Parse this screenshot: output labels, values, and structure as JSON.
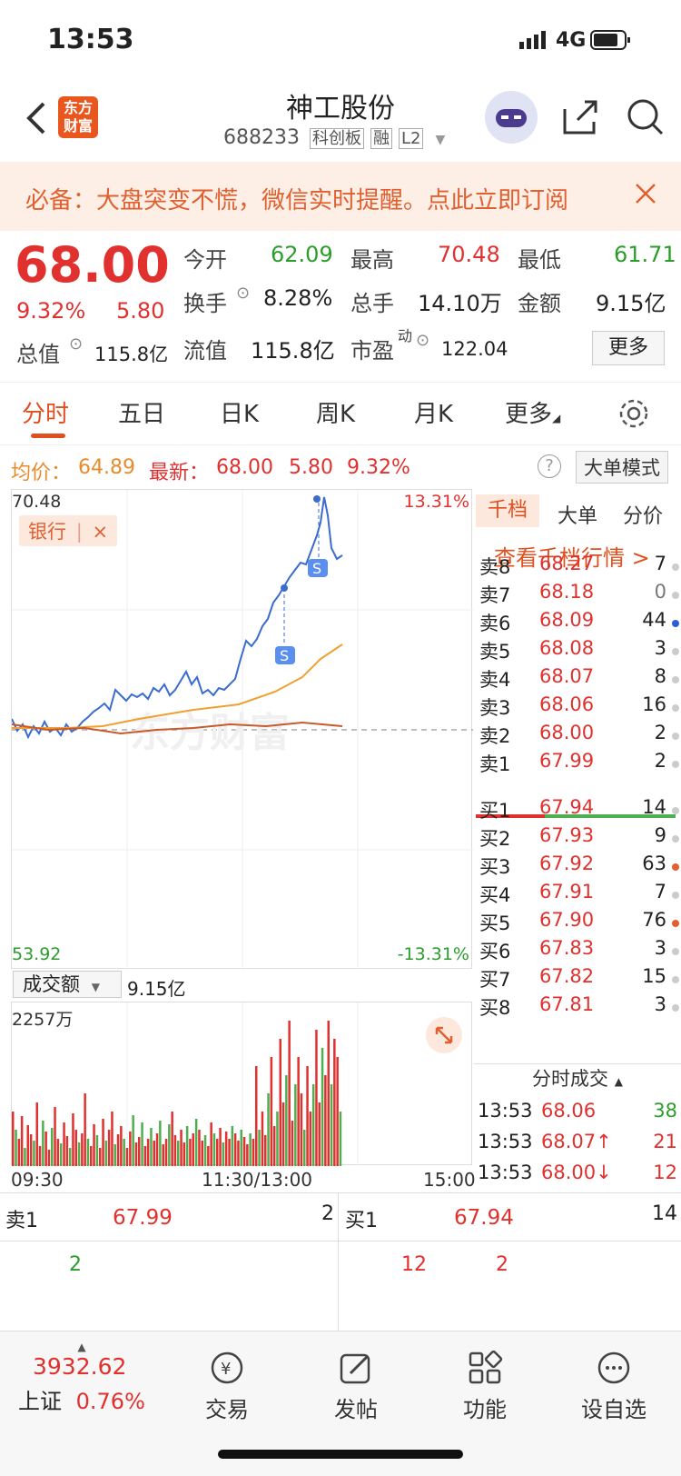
{
  "status": {
    "time": "13:53",
    "network": "4G"
  },
  "header": {
    "title": "神工股份",
    "code": "688233",
    "badges": [
      "科创板",
      "融",
      "L2"
    ],
    "logo_line1": "东方",
    "logo_line2": "财富"
  },
  "banner": {
    "text": "必备：大盘突变不慌，微信实时提醒。点此立即订阅"
  },
  "quote": {
    "price": "68.00",
    "pct": "9.32%",
    "change": "5.80",
    "open_label": "今开",
    "open": "62.09",
    "high_label": "最高",
    "high": "70.48",
    "low_label": "最低",
    "low": "61.71",
    "turnover_label": "换手",
    "turnover": "8.28%",
    "volume_label": "总手",
    "volume": "14.10万",
    "amount_label": "金额",
    "amount": "9.15亿",
    "mcap_label": "总值",
    "mcap": "115.8亿",
    "float_label": "流值",
    "float": "115.8亿",
    "pe_label": "市盈",
    "pe_sup": "动",
    "pe": "122.04",
    "more": "更多"
  },
  "tabs": [
    "分时",
    "五日",
    "日K",
    "周K",
    "月K",
    "更多"
  ],
  "chartinfo": {
    "avg_label": "均价：",
    "avg": "64.89",
    "latest_label": "最新：",
    "latest": "68.00",
    "chg": "5.80",
    "pct": "9.32%",
    "mode": "大单模式",
    "help": "?"
  },
  "chart": {
    "ymax": "70.48",
    "ymin": "53.92",
    "pmax": "13.31%",
    "pmin": "-13.31%",
    "tag": "银行",
    "tag_close": "×",
    "watermark": "东方财富",
    "signal": "S"
  },
  "volume": {
    "selector": "成交额",
    "total": "9.15亿",
    "max": "2257万"
  },
  "xaxis": {
    "start": "09:30",
    "mid": "11:30/13:00",
    "end": "15:00"
  },
  "book": {
    "tabs": [
      "千档",
      "大单",
      "分价"
    ],
    "link": "查看千档行情 >",
    "asks": [
      {
        "label": "卖8",
        "price": "68.27",
        "vol": "7",
        "dot": "#ccc"
      },
      {
        "label": "卖7",
        "price": "68.18",
        "vol": "0",
        "dot": "#ccc"
      },
      {
        "label": "卖6",
        "price": "68.09",
        "vol": "44",
        "dot": "#2c5fd6"
      },
      {
        "label": "卖5",
        "price": "68.08",
        "vol": "3",
        "dot": "#ccc"
      },
      {
        "label": "卖4",
        "price": "68.07",
        "vol": "8",
        "dot": "#ccc"
      },
      {
        "label": "卖3",
        "price": "68.06",
        "vol": "16",
        "dot": "#ccc"
      },
      {
        "label": "卖2",
        "price": "68.00",
        "vol": "2",
        "dot": "#ccc"
      },
      {
        "label": "卖1",
        "price": "67.99",
        "vol": "2",
        "dot": "#ccc"
      }
    ],
    "bids": [
      {
        "label": "买1",
        "price": "67.94",
        "vol": "14",
        "dot": "#ccc"
      },
      {
        "label": "买2",
        "price": "67.93",
        "vol": "9",
        "dot": "#ccc"
      },
      {
        "label": "买3",
        "price": "67.92",
        "vol": "63",
        "dot": "#e0612f"
      },
      {
        "label": "买4",
        "price": "67.91",
        "vol": "7",
        "dot": "#ccc"
      },
      {
        "label": "买5",
        "price": "67.90",
        "vol": "76",
        "dot": "#e0612f"
      },
      {
        "label": "买6",
        "price": "67.83",
        "vol": "3",
        "dot": "#ccc"
      },
      {
        "label": "买7",
        "price": "67.82",
        "vol": "15",
        "dot": "#ccc"
      },
      {
        "label": "买8",
        "price": "67.81",
        "vol": "3",
        "dot": "#ccc"
      }
    ]
  },
  "trades": {
    "title": "分时成交",
    "rows": [
      {
        "time": "13:53",
        "price": "68.06",
        "vol": "38",
        "dir": "",
        "vcolor": "green"
      },
      {
        "time": "13:53",
        "price": "68.07↑",
        "vol": "21",
        "dir": "up",
        "vcolor": "red"
      },
      {
        "time": "13:53",
        "price": "68.00↓",
        "vol": "12",
        "dir": "down",
        "vcolor": "red"
      }
    ]
  },
  "bottom": {
    "sell_label": "卖1",
    "sell_price": "67.99",
    "sell_vol": "2",
    "sell_sub": "2",
    "buy_label": "买1",
    "buy_price": "67.94",
    "buy_vol": "14",
    "buy_sub1": "12",
    "buy_sub2": "2"
  },
  "nav": {
    "index_value": "3932.62",
    "index_name": "上证",
    "index_pct": "0.76%",
    "items": [
      "交易",
      "发帖",
      "功能",
      "设自选"
    ]
  }
}
